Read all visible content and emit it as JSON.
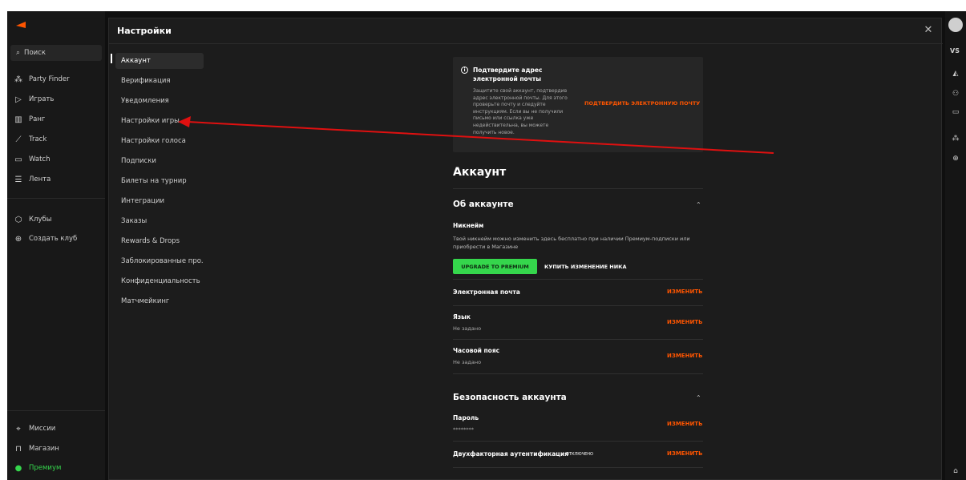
{
  "left_nav": {
    "search": "Поиск",
    "items": [
      {
        "label": "Party Finder",
        "icon": "party-finder-icon"
      },
      {
        "label": "Играть",
        "icon": "play-icon"
      },
      {
        "label": "Ранг",
        "icon": "rank-icon"
      },
      {
        "label": "Track",
        "icon": "track-icon"
      },
      {
        "label": "Watch",
        "icon": "watch-icon"
      },
      {
        "label": "Лента",
        "icon": "feed-icon"
      }
    ],
    "clubs": [
      {
        "label": "Клубы",
        "icon": "clubs-icon"
      },
      {
        "label": "Создать клуб",
        "icon": "create-club-icon"
      }
    ],
    "bottom": [
      {
        "label": "Миссии",
        "icon": "missions-icon"
      },
      {
        "label": "Магазин",
        "icon": "shop-icon"
      },
      {
        "label": "Премиум",
        "icon": "premium-icon"
      }
    ]
  },
  "settings": {
    "title": "Настройки",
    "menu": [
      "Аккаунт",
      "Верификация",
      "Уведомления",
      "Настройки игры",
      "Настройки голоса",
      "Подписки",
      "Билеты на турнир",
      "Интеграции",
      "Заказы",
      "Rewards & Drops",
      "Заблокированные про...",
      "Конфиденциальность",
      "Матчмейкинг"
    ],
    "active_menu_index": 0
  },
  "verify": {
    "title": "Подтвердите адрес электронной почты",
    "text": "Защитите свой аккаунт, подтвердив адрес электронной почты. Для этого проверьте почту и следуйте инструкциям. Если вы не получили письмо или ссылка уже недействительна, вы можете получить новое.",
    "link": "ПОДТВЕРДИТЬ ЭЛЕКТРОННУЮ ПОЧТУ"
  },
  "account": {
    "heading": "Аккаунт",
    "about": {
      "title": "Об аккаунте",
      "nickname_label": "Никнейм",
      "nickname_desc": "Твой никнейм можно изменить здесь бесплатно при наличии Премиум-подписки или приобрести в Магазине",
      "upgrade_btn": "UPGRADE TO PREMIUM",
      "buy_btn": "КУПИТЬ ИЗМЕНЕНИЕ НИКА",
      "email_label": "Электронная почта",
      "lang_label": "Язык",
      "lang_value": "Не задано",
      "tz_label": "Часовой пояс",
      "tz_value": "Не задано",
      "change": "ИЗМЕНИТЬ"
    },
    "security": {
      "title": "Безопасность аккаунта",
      "password_label": "Пароль",
      "password_value": "********",
      "twofa_label": "Двухфакторная аутентификация",
      "twofa_status": "ОТКЛЮЧЕНО",
      "change": "ИЗМЕНИТЬ"
    }
  },
  "right_bar": {
    "label": "VS"
  },
  "colors": {
    "accent": "#ff5500",
    "premium_green": "#35d64c",
    "annotation": "#e01010"
  }
}
